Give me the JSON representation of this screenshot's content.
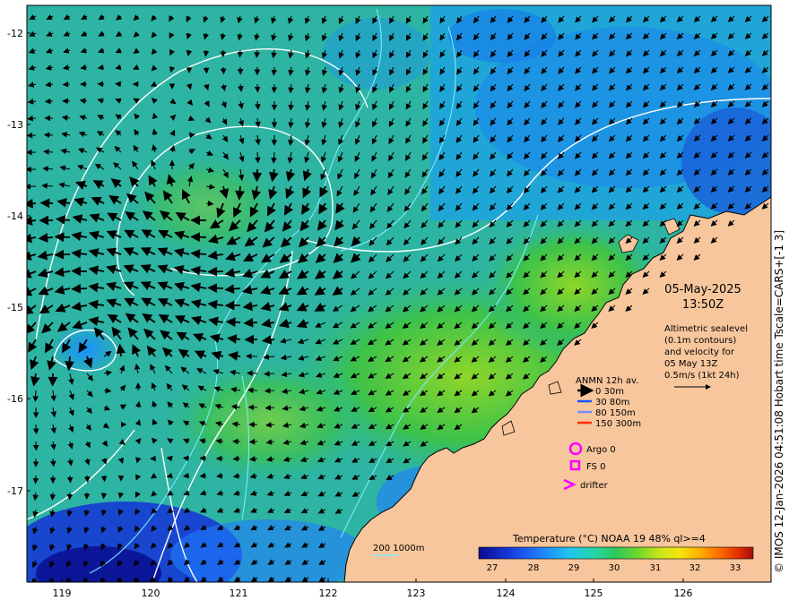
{
  "map": {
    "lon_ticks": [
      "119",
      "120",
      "121",
      "122",
      "123",
      "124",
      "125",
      "126"
    ],
    "lat_ticks": [
      "-12",
      "-13",
      "-14",
      "-15",
      "-16",
      "-17"
    ],
    "date": "05-May-2025",
    "time": "13:50Z",
    "altimetry_lines": [
      "Altimetric sealevel",
      "(0.1m contours)",
      "and velocity for",
      "05 May 13Z",
      "0.5m/s (1kt 24h)"
    ],
    "legend": {
      "title": "ANMN 12h av.",
      "items": [
        {
          "label": "0 30m",
          "color": "#000000"
        },
        {
          "label": "30 80m",
          "color": "#1a55ff"
        },
        {
          "label": "80 150m",
          "color": "#7a8cff"
        },
        {
          "label": "150 300m",
          "color": "#ff2a00"
        }
      ],
      "argo": "Argo 0",
      "fs": "FS 0",
      "drifter": "drifter",
      "marker_color": "#ff00ff"
    },
    "bathymetry_label": "200  1000m",
    "colorbar": {
      "title": "Temperature (°C) NOAA 19 48% ql>=4",
      "ticks": [
        "27",
        "28",
        "29",
        "30",
        "31",
        "32",
        "33"
      ],
      "colors": [
        "#0a0a8c",
        "#1533d6",
        "#1f7cff",
        "#22c4f0",
        "#25d6a6",
        "#2ec85a",
        "#6fd62a",
        "#c8e61a",
        "#f2e60f",
        "#ffb300",
        "#ff6a00",
        "#e02a00",
        "#a01010"
      ]
    },
    "credit": "© IMOS 12-Jan-2026 04:51:08 Hobart time Tscale=CARS+[-1 3]",
    "colors": {
      "land": "#f8c69c",
      "warm_sst": "#34c25a",
      "mid_sst": "#2bb6a8",
      "cool_sst": "#1f8fe0",
      "cold_sst": "#1a3cd6",
      "contour_white": "#ffffff",
      "contour_cyan": "#7fe8ff"
    }
  }
}
